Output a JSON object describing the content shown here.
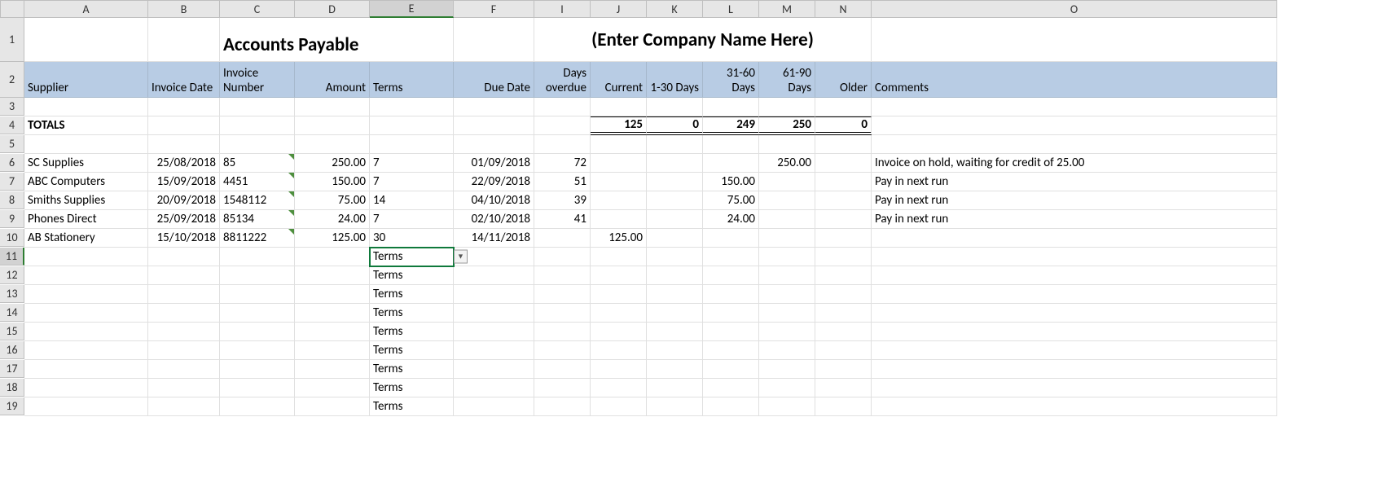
{
  "columns": [
    "A",
    "B",
    "C",
    "D",
    "E",
    "F",
    "I",
    "J",
    "K",
    "L",
    "M",
    "N",
    "O"
  ],
  "title_left": "Accounts Payable",
  "title_right": "(Enter Company Name Here)",
  "headers": {
    "supplier": "Supplier",
    "invoice_date": "Invoice Date",
    "invoice_number": "Invoice Number",
    "amount": "Amount",
    "terms": "Terms",
    "due_date": "Due Date",
    "days_overdue": "Days overdue",
    "current": "Current",
    "d1_30": "1-30 Days",
    "d31_60": "31-60 Days",
    "d61_90": "61-90 Days",
    "older": "Older",
    "comments": "Comments"
  },
  "totals_label": "TOTALS",
  "totals": {
    "current": "125",
    "d1_30": "0",
    "d31_60": "249",
    "d61_90": "250",
    "older": "0"
  },
  "rows": [
    {
      "supplier": "SC Supplies",
      "invoice_date": "25/08/2018",
      "invoice_number": "85",
      "amount": "250.00",
      "terms": "7",
      "due_date": "01/09/2018",
      "days_overdue": "72",
      "current": "",
      "d1_30": "",
      "d31_60": "",
      "d61_90": "250.00",
      "older": "",
      "comments": "Invoice on hold, waiting for credit of 25.00"
    },
    {
      "supplier": "ABC Computers",
      "invoice_date": "15/09/2018",
      "invoice_number": "4451",
      "amount": "150.00",
      "terms": "7",
      "due_date": "22/09/2018",
      "days_overdue": "51",
      "current": "",
      "d1_30": "",
      "d31_60": "150.00",
      "d61_90": "",
      "older": "",
      "comments": "Pay in next run"
    },
    {
      "supplier": "Smiths Supplies",
      "invoice_date": "20/09/2018",
      "invoice_number": "1548112",
      "amount": "75.00",
      "terms": "14",
      "due_date": "04/10/2018",
      "days_overdue": "39",
      "current": "",
      "d1_30": "",
      "d31_60": "75.00",
      "d61_90": "",
      "older": "",
      "comments": "Pay in next run"
    },
    {
      "supplier": "Phones Direct",
      "invoice_date": "25/09/2018",
      "invoice_number": "85134",
      "amount": "24.00",
      "terms": "7",
      "due_date": "02/10/2018",
      "days_overdue": "41",
      "current": "",
      "d1_30": "",
      "d31_60": "24.00",
      "d61_90": "",
      "older": "",
      "comments": "Pay in next run"
    },
    {
      "supplier": "AB Stationery",
      "invoice_date": "15/10/2018",
      "invoice_number": "8811222",
      "amount": "125.00",
      "terms": "30",
      "due_date": "14/11/2018",
      "days_overdue": "",
      "current": "125.00",
      "d1_30": "",
      "d31_60": "",
      "d61_90": "",
      "older": "",
      "comments": ""
    }
  ],
  "terms_placeholder": "Terms",
  "active_value": "Terms",
  "term_repeats": 8
}
